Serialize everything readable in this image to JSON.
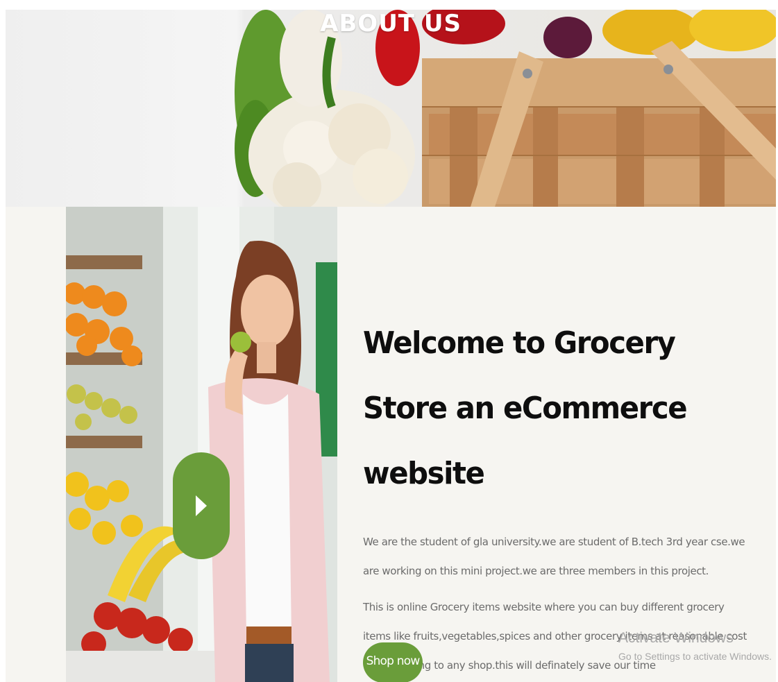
{
  "hero": {
    "title": "ABOUT US"
  },
  "about": {
    "heading": "Welcome to Grocery Store an eCommerce website",
    "paragraph_1": "We are the student of gla university.we are student of B.tech 3rd year cse.we are working on this mini project.we are three members in this project.",
    "paragraph_2": "This is online Grocery items website where you can buy different grocery items like fruits,vegetables,spices and other grocery items at reasonable cost without going to any shop.this will definately save our time",
    "shop_button_label": "Shop now",
    "play_icon": "play-icon"
  },
  "overlay": {
    "activate_title": "Activate Windows",
    "activate_subtitle": "Go to Settings to activate Windows."
  },
  "colors": {
    "accent_green": "#6a9d3a",
    "section_bg": "#f6f5f1",
    "heading_text": "#0e0e0e",
    "body_text": "#6b6b6b"
  }
}
